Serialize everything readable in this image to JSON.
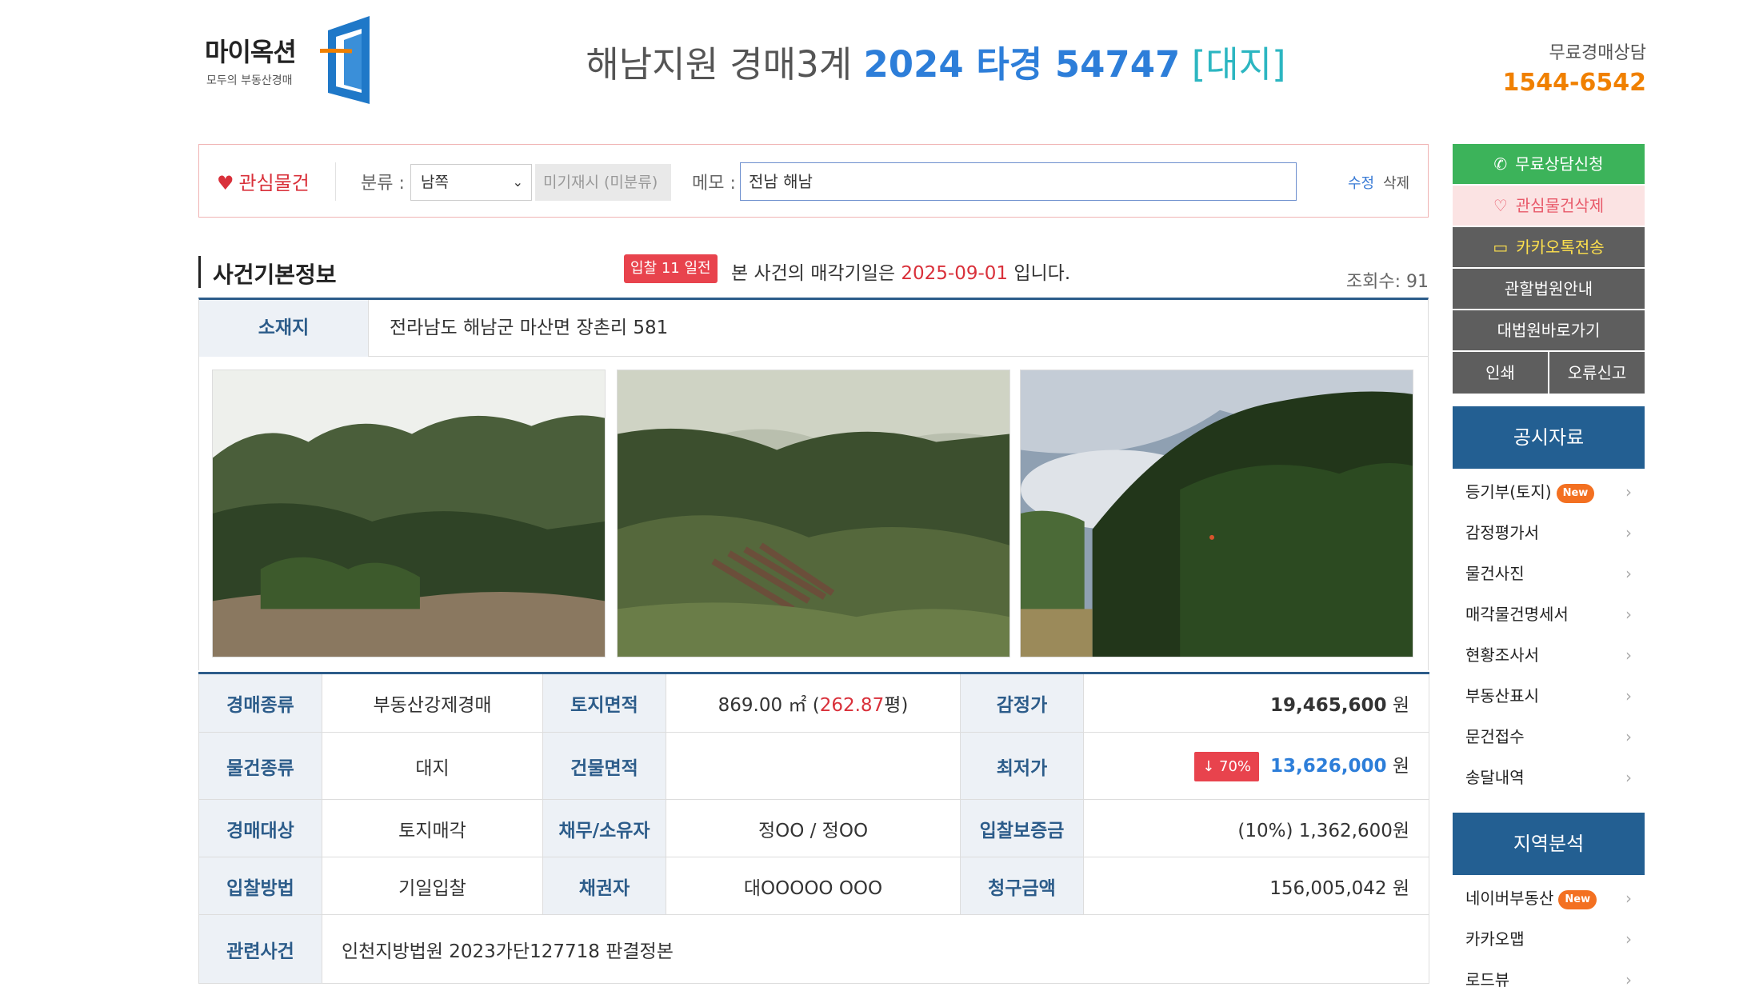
{
  "header": {
    "logo_text": "마이옥션",
    "logo_sub": "모두의 부동산경매",
    "title_prefix": "해남지원 경매3계",
    "title_case": "2024 타경 54747",
    "title_kind": "[대지]",
    "consult_label": "무료경매상담",
    "consult_phone": "1544-6542"
  },
  "memo_bar": {
    "favorite_label": "관심물건",
    "category_label": "분류 :",
    "category_value": "남쪽",
    "uncategorized": "미기재시 (미분류)",
    "memo_label": "메모 :",
    "memo_value": "전남 해남",
    "edit": "수정",
    "delete": "삭제"
  },
  "section": {
    "title": "사건기본정보",
    "bid_badge": "입찰 11 일전",
    "bid_text_pre": "본 사건의 매각기일은",
    "bid_date": "2025-09-01",
    "bid_text_post": "입니다.",
    "views": "조회수: 91"
  },
  "location": {
    "label": "소재지",
    "value": "전라남도 해남군 마산면 장촌리 581"
  },
  "info": {
    "auction_type_label": "경매종류",
    "auction_type": "부동산강제경매",
    "land_area_label": "토지면적",
    "land_area": "869.00 ㎡ (",
    "land_area_pyeong": "262.87",
    "land_area_unit": "평)",
    "appraisal_label": "감정가",
    "appraisal": "19,465,600",
    "won": "원",
    "item_type_label": "물건종류",
    "item_type": "대지",
    "building_area_label": "건물면적",
    "building_area": "",
    "min_price_label": "최저가",
    "min_rate": "↓ 70%",
    "min_price": "13,626,000",
    "target_label": "경매대상",
    "target": "토지매각",
    "debtor_label": "채무/소유자",
    "debtor": "정OO / 정OO",
    "deposit_label": "입찰보증금",
    "deposit": "(10%) 1,362,600원",
    "method_label": "입찰방법",
    "method": "기일입찰",
    "creditor_label": "채권자",
    "creditor": "대OOOOO OOO",
    "claim_label": "청구금액",
    "claim": "156,005,042 원",
    "related_label": "관련사건",
    "related": "인천지방법원 2023가단127718 판결정본"
  },
  "sidebar": {
    "consult_request": "무료상담신청",
    "fav_delete": "관심물건삭제",
    "kakao_send": "카카오톡전송",
    "court_info": "관할법원안내",
    "supreme_court": "대법원바로가기",
    "print": "인쇄",
    "report_error": "오류신고",
    "public_head": "공시자료",
    "public_items": [
      {
        "label": "등기부(토지)",
        "badge": "New"
      },
      {
        "label": "감정평가서",
        "badge": ""
      },
      {
        "label": "물건사진",
        "badge": ""
      },
      {
        "label": "매각물건명세서",
        "badge": ""
      },
      {
        "label": "현황조사서",
        "badge": ""
      },
      {
        "label": "부동산표시",
        "badge": ""
      },
      {
        "label": "문건접수",
        "badge": ""
      },
      {
        "label": "송달내역",
        "badge": ""
      }
    ],
    "region_head": "지역분석",
    "region_items": [
      {
        "label": "네이버부동산",
        "badge": "New"
      },
      {
        "label": "카카오맵",
        "badge": ""
      },
      {
        "label": "로드뷰",
        "badge": ""
      }
    ]
  },
  "colors": {
    "accent_blue": "#2d7ed9",
    "navy": "#235f92",
    "orange": "#f08000",
    "red": "#d9303a",
    "green": "#3cb35a"
  }
}
